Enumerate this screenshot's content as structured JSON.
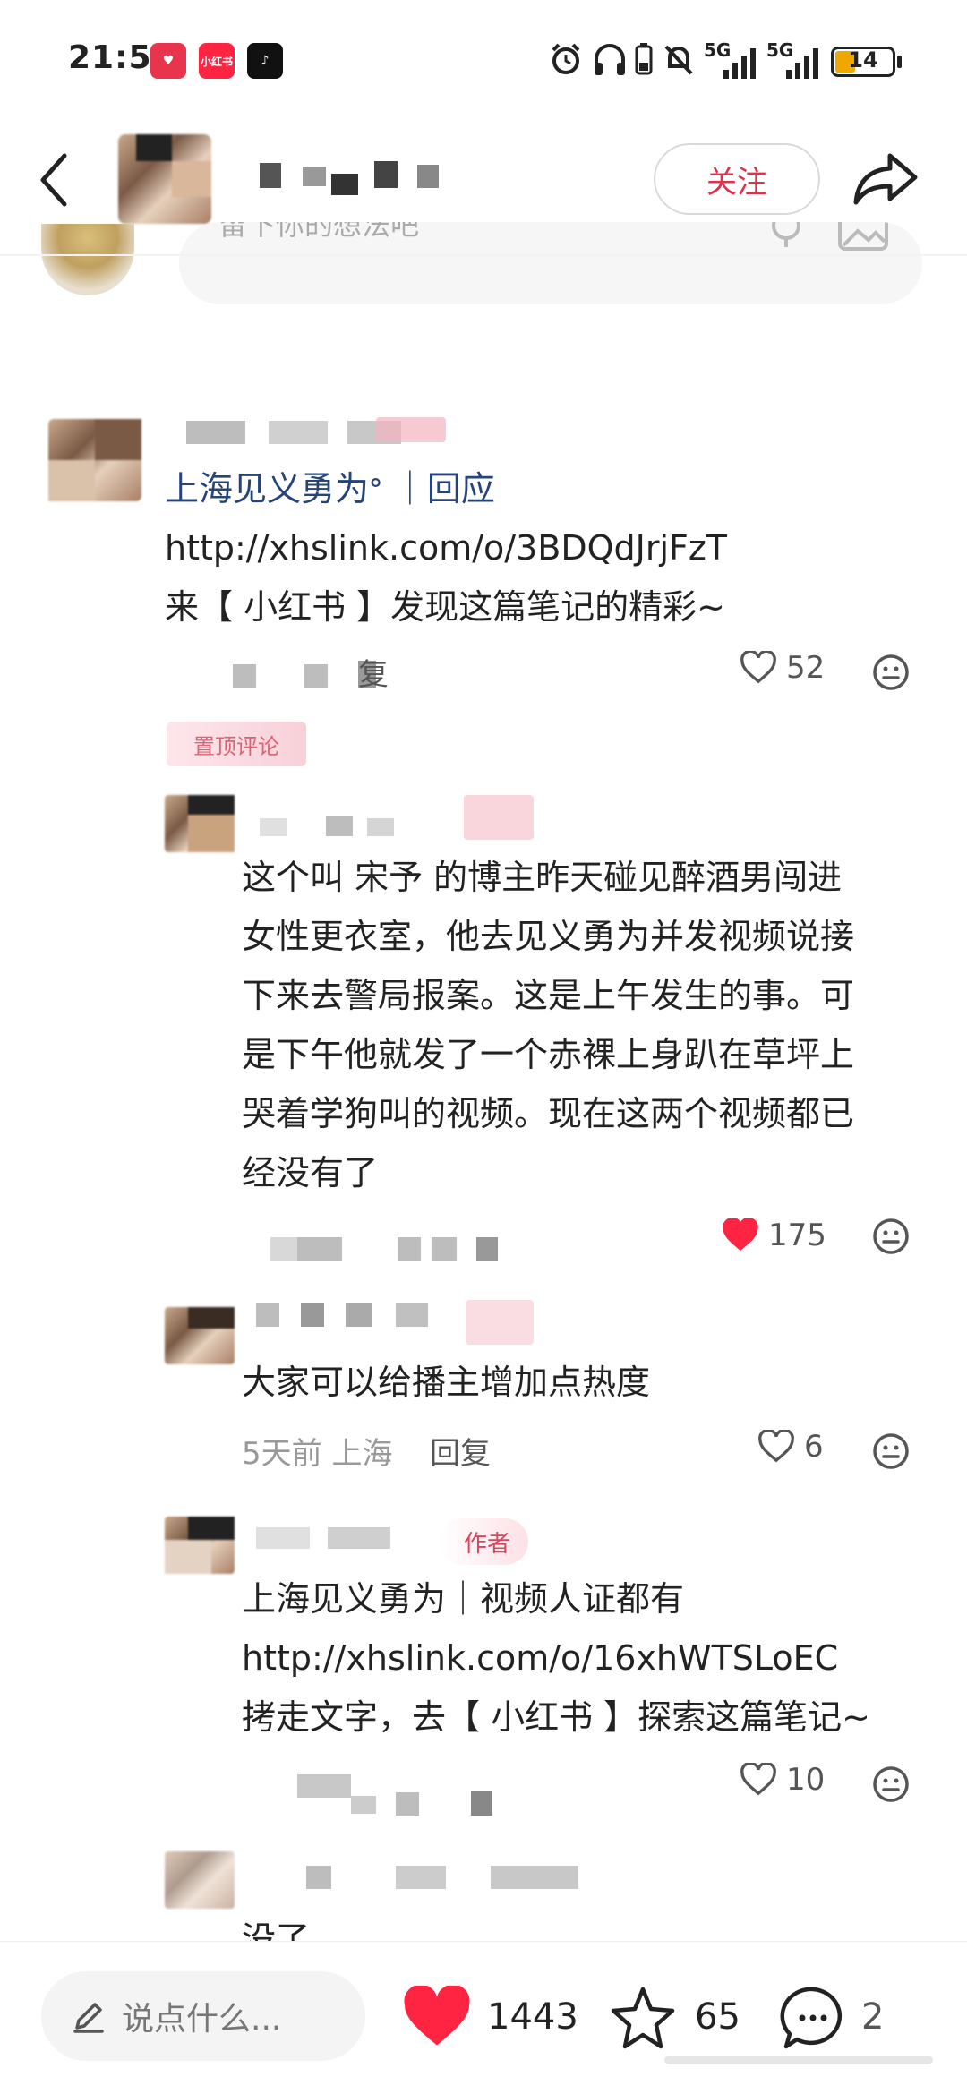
{
  "status_bar": {
    "time": "21:57",
    "apps": [
      {
        "name": "xiaohongshu-heart-icon",
        "label": "♥"
      },
      {
        "name": "xiaohongshu-app-icon",
        "label": "小红书"
      },
      {
        "name": "tiktok-icon",
        "label": "♪"
      }
    ],
    "network_1": "5G",
    "network_2": "5G",
    "battery": "14"
  },
  "header": {
    "follow_label": "关注"
  },
  "comment_input": {
    "placeholder": "留下你的想法吧"
  },
  "comments": [
    {
      "line1": "上海见义勇为ᐤ ｜回应",
      "line2": "http://xhslink.com/o/3BDQdJrjFzT",
      "line3": "来【 小红书 】发现这篇笔记的精彩~",
      "reply_label": "回复",
      "likes": "52",
      "liked": false,
      "tag": "置顶评论"
    },
    {
      "lines": [
        "这个叫 宋予 的博主昨天碰见醉酒男闯进",
        "女性更衣室，他去见义勇为并发视频说接",
        "下来去警局报案。这是上午发生的事。可",
        "是下午他就发了一个赤裸上身趴在草坪上",
        "哭着学狗叫的视频。现在这两个视频都已",
        "经没有了"
      ],
      "reply_label": "回复",
      "likes": "175",
      "liked": true
    },
    {
      "text": "大家可以给播主增加点热度",
      "time_location": "5天前 上海",
      "reply_label": "回复",
      "likes": "6",
      "liked": false
    },
    {
      "author_badge": "作者",
      "line1": "上海见义勇为｜视频人证都有",
      "line2": "http://xhslink.com/o/16xhWTSLoEC",
      "line3": "拷走文字，去【 小红书 】探索这篇笔记~",
      "likes": "10",
      "liked": false
    },
    {
      "text": "没了……"
    }
  ],
  "bottom_bar": {
    "say_placeholder": "说点什么...",
    "likes": "1443",
    "stars": "65",
    "comments": "2"
  },
  "colors": {
    "accent_red": "#e0304a",
    "heart_red": "#ff2442"
  }
}
